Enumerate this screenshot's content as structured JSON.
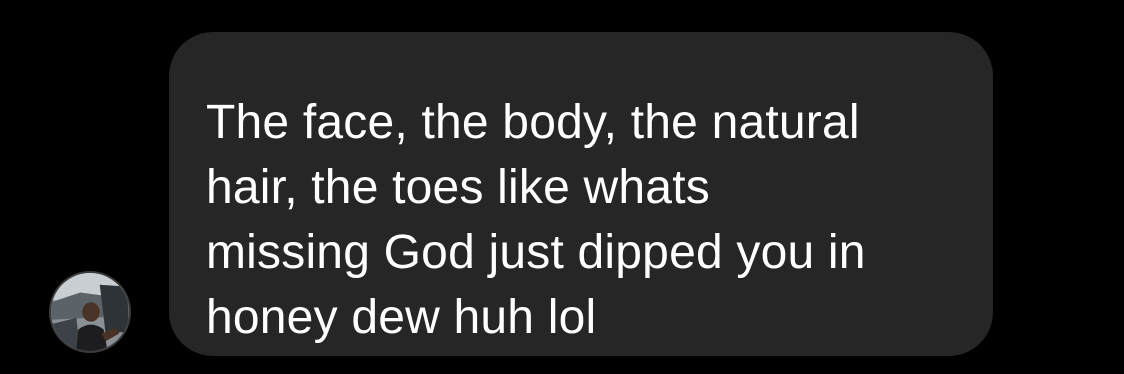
{
  "conversation": {
    "background_color": "#000000",
    "messages": [
      {
        "direction": "incoming",
        "text": "The face, the body, the natural\nhair, the toes like whats\nmissing God just dipped you in\nhoney dew huh lol",
        "bubble_color": "#262626",
        "text_color": "#ffffff",
        "sender_avatar": "profile-photo"
      }
    ]
  }
}
